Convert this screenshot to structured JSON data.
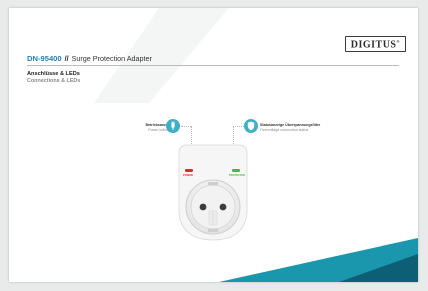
{
  "brand": {
    "logo_text": "DIGITUS"
  },
  "header": {
    "model": "DN-95400",
    "separator": "//",
    "product_name": "Surge Protection Adapter"
  },
  "section": {
    "title_de": "Anschlüsse & LEDs",
    "title_en": "Connections & LEDs"
  },
  "callouts": [
    {
      "label_de": "Betriebsanzeige",
      "label_en": "Power indicator",
      "badge_icon": "power-plug-icon"
    },
    {
      "label_de": "Statusanzeige Überspannungsfilter",
      "label_en": "Overvoltage connection status",
      "badge_icon": "shield-icon"
    }
  ],
  "device": {
    "led_power_label": "POWER",
    "led_protected_label": "PROTECTED",
    "led_power_color": "#e4262c",
    "led_protected_color": "#44b845"
  },
  "colors": {
    "accent": "#2a7fb4",
    "badge": "#3eafc4",
    "decor_teal": "#1b97ad",
    "decor_dark": "#0d5f75"
  }
}
